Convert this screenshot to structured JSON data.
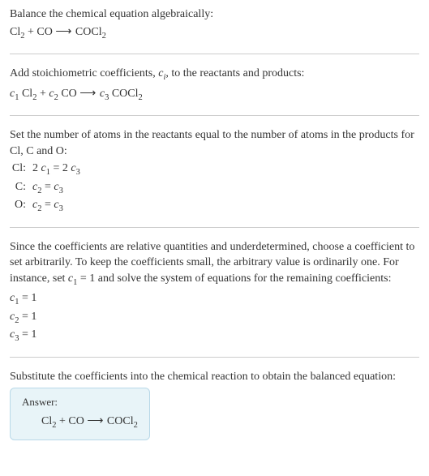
{
  "s1": {
    "title": "Balance the chemical equation algebraically:",
    "eq_pre": "Cl",
    "eq_sub1": "2",
    "eq_mid1": " + CO ",
    "arrow": "⟶",
    "eq_mid2": " COCl",
    "eq_sub2": "2"
  },
  "s2": {
    "title_pre": "Add stoichiometric coefficients, ",
    "ci_c": "c",
    "ci_i": "i",
    "title_post": ", to the reactants and products:",
    "c1": "c",
    "c1s": "1",
    "r1a": " Cl",
    "r1b": "2",
    "plus": " + ",
    "c2": "c",
    "c2s": "2",
    "r2": " CO ",
    "arrow": "⟶",
    "sp": " ",
    "c3": "c",
    "c3s": "3",
    "p1a": " COCl",
    "p1b": "2"
  },
  "s3": {
    "title": "Set the number of atoms in the reactants equal to the number of atoms in the products for Cl, C and O:",
    "rows": [
      {
        "label": "Cl:",
        "pre": "2 ",
        "c1": "c",
        "c1s": "1",
        "mid": " = 2 ",
        "c2": "c",
        "c2s": "3"
      },
      {
        "label": "C:",
        "pre": "",
        "c1": "c",
        "c1s": "2",
        "mid": " = ",
        "c2": "c",
        "c2s": "3"
      },
      {
        "label": "O:",
        "pre": "",
        "c1": "c",
        "c1s": "2",
        "mid": " = ",
        "c2": "c",
        "c2s": "3"
      }
    ]
  },
  "s4": {
    "title_pre": "Since the coefficients are relative quantities and underdetermined, choose a coefficient to set arbitrarily. To keep the coefficients small, the arbitrary value is ordinarily one. For instance, set ",
    "cv": "c",
    "cvs": "1",
    "title_post": " = 1 and solve the system of equations for the remaining coefficients:",
    "lines": [
      {
        "c": "c",
        "s": "1",
        "rhs": " = 1"
      },
      {
        "c": "c",
        "s": "2",
        "rhs": " = 1"
      },
      {
        "c": "c",
        "s": "3",
        "rhs": " = 1"
      }
    ]
  },
  "s5": {
    "title": "Substitute the coefficients into the chemical reaction to obtain the balanced equation:",
    "answer_label": "Answer:",
    "eq_pre": "Cl",
    "eq_sub1": "2",
    "eq_mid1": " + CO ",
    "arrow": "⟶",
    "eq_mid2": " COCl",
    "eq_sub2": "2"
  }
}
